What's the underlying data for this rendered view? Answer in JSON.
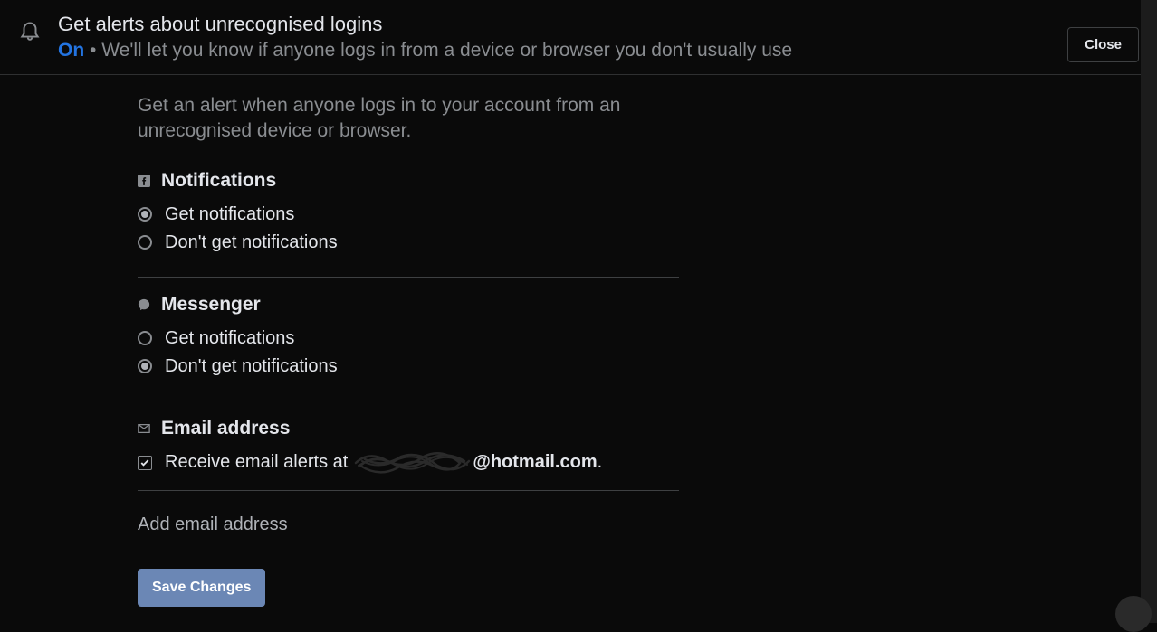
{
  "header": {
    "title": "Get alerts about unrecognised logins",
    "status": "On",
    "separator": " • ",
    "subtitle": "We'll let you know if anyone logs in from a device or browser you don't usually use",
    "close_label": "Close"
  },
  "content": {
    "intro": "Get an alert when anyone logs in to your account from an unrecognised device or browser."
  },
  "notifications": {
    "title": "Notifications",
    "options": {
      "get": "Get notifications",
      "dont": "Don't get notifications"
    },
    "selected": "get"
  },
  "messenger": {
    "title": "Messenger",
    "options": {
      "get": "Get notifications",
      "dont": "Don't get notifications"
    },
    "selected": "dont"
  },
  "email": {
    "title": "Email address",
    "receive_prefix": "Receive email alerts at ",
    "domain": "@hotmail.com",
    "period": ".",
    "checked": true
  },
  "add_email_label": "Add email address",
  "save_label": "Save Changes"
}
